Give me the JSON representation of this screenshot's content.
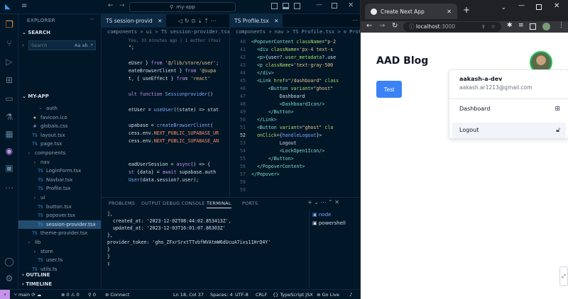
{
  "vscode": {
    "search_box": "my-app",
    "sidebar": {
      "explorer_label": "EXPLORER",
      "search_label": "SEARCH",
      "search_placeholder": "Search",
      "search_opts": "Aa ab .*",
      "project_label": "MY-APP",
      "outline_label": "OUTLINE",
      "timeline_label": "TIMELINE",
      "tree": [
        {
          "label": "auth",
          "indent": 2,
          "kind": "folder"
        },
        {
          "label": "favicon.ico",
          "indent": 1,
          "kind": "star"
        },
        {
          "label": "globals.css",
          "indent": 1,
          "kind": "hash"
        },
        {
          "label": "layout.tsx",
          "indent": 1,
          "kind": "ts"
        },
        {
          "label": "page.tsx",
          "indent": 1,
          "kind": "ts"
        },
        {
          "label": "components",
          "indent": 0,
          "kind": "folder"
        },
        {
          "label": "nav",
          "indent": 1,
          "kind": "folder"
        },
        {
          "label": "LoginForm.tsx",
          "indent": 2,
          "kind": "ts"
        },
        {
          "label": "Navbar.tsx",
          "indent": 2,
          "kind": "ts"
        },
        {
          "label": "Profile.tsx",
          "indent": 2,
          "kind": "ts"
        },
        {
          "label": "ui",
          "indent": 1,
          "kind": "folder"
        },
        {
          "label": "button.tsx",
          "indent": 2,
          "kind": "ts"
        },
        {
          "label": "popover.tsx",
          "indent": 2,
          "kind": "ts"
        },
        {
          "label": "session-provider.tsx",
          "indent": 2,
          "kind": "ts",
          "active": true
        },
        {
          "label": "theme-provider.tsx",
          "indent": 1,
          "kind": "ts"
        },
        {
          "label": "lib",
          "indent": 0,
          "kind": "folder"
        },
        {
          "label": "store",
          "indent": 1,
          "kind": "folder"
        },
        {
          "label": "user.ts",
          "indent": 2,
          "kind": "ts"
        },
        {
          "label": "utils.ts",
          "indent": 1,
          "kind": "ts"
        }
      ]
    },
    "editor1": {
      "tab": "TS session-provid",
      "breadcrumb": "components > ui > TS session-provider.tsx > ⊙ Sessi",
      "blame": "You, 33 minutes ago | 1 author (You)",
      "lines": [
        [
          {
            "c": "v",
            "t": "\";"
          }
        ],
        [],
        [
          {
            "c": "v",
            "t": "eUser } "
          },
          {
            "c": "k",
            "t": "from"
          },
          {
            "c": "s",
            "t": " '@/lib/store/user'"
          },
          {
            "c": "v",
            "t": ";"
          }
        ],
        [
          {
            "c": "v",
            "t": "eateBrowserClient } "
          },
          {
            "c": "k",
            "t": "from"
          },
          {
            "c": "s",
            "t": " '@supa"
          }
        ],
        [
          {
            "c": "v",
            "t": "t, { useEffect } "
          },
          {
            "c": "k",
            "t": "from"
          },
          {
            "c": "s",
            "t": " 'react'"
          }
        ],
        [],
        [
          {
            "c": "k",
            "t": "ult function "
          },
          {
            "c": "f",
            "t": "Sessionprovider"
          },
          {
            "c": "v",
            "t": "()"
          }
        ],
        [],
        [
          {
            "c": "v",
            "t": "etUser = "
          },
          {
            "c": "f",
            "t": "useUser"
          },
          {
            "c": "v",
            "t": "((state) => stat"
          }
        ],
        [],
        [
          {
            "c": "v",
            "t": "upabase = "
          },
          {
            "c": "f",
            "t": "createBrowserClient"
          },
          {
            "c": "v",
            "t": "("
          }
        ],
        [
          {
            "c": "v",
            "t": "cess.env."
          },
          {
            "c": "o",
            "t": "NEXT_PUBLIC_SUPABASE_UR"
          }
        ],
        [
          {
            "c": "v",
            "t": "cess.env."
          },
          {
            "c": "o",
            "t": "NEXT_PUBLIC_SUPABASE_AN"
          }
        ],
        [],
        [],
        [
          {
            "c": "v",
            "t": "eadUserSession = "
          },
          {
            "c": "k",
            "t": "async"
          },
          {
            "c": "v",
            "t": "() => {"
          }
        ],
        [
          {
            "c": "k",
            "t": "st"
          },
          {
            "c": "v",
            "t": " {data} = "
          },
          {
            "c": "k",
            "t": "await"
          },
          {
            "c": "v",
            "t": " supabase.auth"
          }
        ],
        [
          {
            "c": "f",
            "t": "User"
          },
          {
            "c": "v",
            "t": "(data.session?.user);"
          }
        ]
      ]
    },
    "editor2": {
      "tab": "TS Profile.tsx",
      "breadcrumb": "components > nav > TS Profile.tsx > ⊙ Profile",
      "line_numbers": [
        "40",
        "41",
        "42",
        "43",
        "44",
        "45",
        "46",
        "47",
        "48",
        "49",
        "50",
        "51",
        "52",
        "53",
        "54",
        "55",
        "56",
        "57",
        "58",
        "59"
      ],
      "active_line": "52",
      "lines": [
        [
          {
            "c": "p",
            "t": "<PopoverContent "
          },
          {
            "c": "t",
            "t": "className"
          },
          {
            "c": "v",
            "t": "="
          },
          {
            "c": "s",
            "t": "\"p-2"
          }
        ],
        [
          {
            "c": "p",
            "t": "  <div "
          },
          {
            "c": "t",
            "t": "className"
          },
          {
            "c": "v",
            "t": "="
          },
          {
            "c": "s",
            "t": "'px-4 text-s"
          }
        ],
        [
          {
            "c": "p",
            "t": "  <p>"
          },
          {
            "c": "v",
            "t": "{user?."
          },
          {
            "c": "t",
            "t": "user_metadata"
          },
          {
            "c": "v",
            "t": "?.use"
          }
        ],
        [
          {
            "c": "p",
            "t": "  <p "
          },
          {
            "c": "t",
            "t": "className"
          },
          {
            "c": "v",
            "t": "="
          },
          {
            "c": "s",
            "t": "'text-gray-500"
          }
        ],
        [
          {
            "c": "p",
            "t": "  </div>"
          }
        ],
        [
          {
            "c": "p",
            "t": "  <Link "
          },
          {
            "c": "t",
            "t": "href"
          },
          {
            "c": "v",
            "t": "="
          },
          {
            "c": "s",
            "t": "\"/dashboard\""
          },
          {
            "c": "t",
            "t": " class"
          }
        ],
        [
          {
            "c": "p",
            "t": "      <Button "
          },
          {
            "c": "t",
            "t": "variant"
          },
          {
            "c": "v",
            "t": "="
          },
          {
            "c": "s",
            "t": "\"ghost\""
          }
        ],
        [
          {
            "c": "v",
            "t": "          Dashboard"
          }
        ],
        [
          {
            "c": "p",
            "t": "          <DashboardIcon/>"
          }
        ],
        [
          {
            "c": "p",
            "t": "      </Button>"
          }
        ],
        [
          {
            "c": "p",
            "t": "  </Link>"
          }
        ],
        [
          {
            "c": "p",
            "t": "  <Button "
          },
          {
            "c": "t",
            "t": "variant"
          },
          {
            "c": "v",
            "t": "="
          },
          {
            "c": "s",
            "t": "\"ghost\""
          },
          {
            "c": "t",
            "t": " cla"
          }
        ],
        [
          {
            "c": "t",
            "t": "  onClick"
          },
          {
            "c": "v",
            "t": "={"
          },
          {
            "c": "f",
            "t": "handleLogout"
          },
          {
            "c": "v",
            "t": "}>"
          }
        ],
        [
          {
            "c": "v",
            "t": "          Logout"
          }
        ],
        [
          {
            "c": "p",
            "t": "          <LockOpen1Icon/>"
          }
        ],
        [
          {
            "c": "p",
            "t": "      </Button>"
          }
        ],
        [
          {
            "c": "p",
            "t": "  </PopoverContent>"
          }
        ],
        [
          {
            "c": "p",
            "t": "</Popover>"
          }
        ],
        [],
        []
      ]
    },
    "panel": {
      "tabs": [
        "PROBLEMS",
        "OUTPUT",
        "DEBUG CONSOLE",
        "TERMINAL",
        "PORTS"
      ],
      "active_tab": "TERMINAL",
      "terminal_lines": [
        "],",
        "  created_at: '2023-12-02T08:44:02.853413Z',",
        "  updated_at: '2023-12-03T16:01:07.86303Z'",
        "},",
        "provider_token: 'gho_ZFxrSrxtTTvbfWVAtmW6dUcuA7ixs11HrQ4Y'",
        "}",
        "}",
        "▯"
      ],
      "terminals": [
        {
          "label": "node",
          "active": true
        },
        {
          "label": "powershell",
          "active": false
        }
      ]
    },
    "status": {
      "branch": "main",
      "problems": "⊗ 0 ⚠ 0",
      "ports": "⚲ 0",
      "connect": "Connect",
      "ln_col": "Ln 18, Col 37",
      "spaces": "Spaces: 4",
      "encoding": "UTF-8",
      "eol": "CRLF",
      "language": "{} TypeScript JSX",
      "golive": "⊚ Go Live"
    }
  },
  "browser": {
    "tab_title": "Create Next App",
    "url_host": "localhost",
    "url_port": ":3000",
    "app_title": "AAD Blog",
    "test_button": "Test",
    "user_name": "aakash-a-dev",
    "user_email": "aakash.ar1213@gmail.com",
    "menu_dashboard": "Dashboard",
    "menu_logout": "Logout",
    "colors": {
      "primary": "#3b82f6",
      "active_bg": "#f1f5f9"
    }
  }
}
